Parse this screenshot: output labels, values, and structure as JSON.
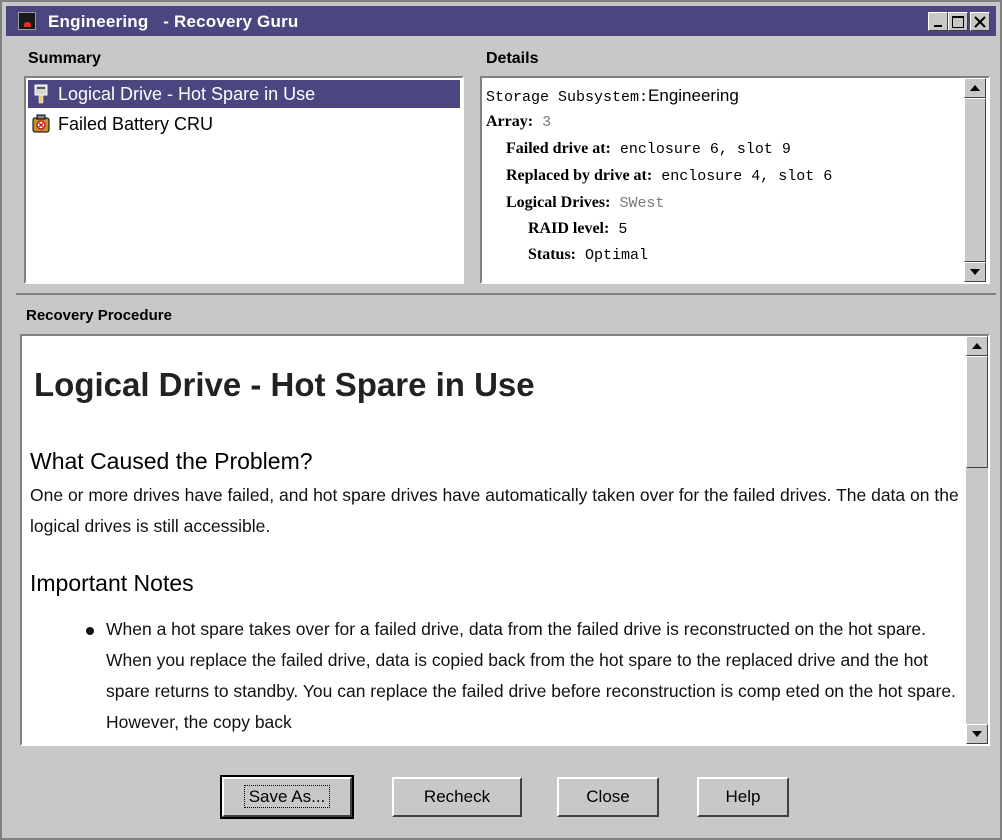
{
  "window": {
    "title": "Engineering   - Recovery Guru",
    "title_bar_color": "#4b4580"
  },
  "summary": {
    "header": "Summary",
    "items": [
      {
        "label": "Logical Drive - Hot Spare in Use",
        "icon": "hot-spare-drive-icon",
        "selected": true
      },
      {
        "label": "Failed Battery CRU",
        "icon": "battery-warning-icon",
        "selected": false
      }
    ]
  },
  "details": {
    "header": "Details",
    "storage_subsystem_label": "Storage Subsystem:",
    "storage_subsystem_value": "Engineering",
    "array_label": "Array:",
    "array_value": "3",
    "failed_drive_label": "Failed drive at:",
    "failed_drive_value": "enclosure 6, slot 9",
    "replaced_by_label": "Replaced by drive at:",
    "replaced_by_value": "enclosure 4, slot 6",
    "logical_drives_label": "Logical Drives:",
    "logical_drives_value": "SWest",
    "raid_level_label": "RAID level:",
    "raid_level_value": "5",
    "status_label": "Status:",
    "status_value": "Optimal"
  },
  "procedure": {
    "header": "Recovery Procedure",
    "title": "Logical Drive - Hot Spare in Use",
    "cause_heading": "What Caused the Problem?",
    "cause_text": "One or more drives have failed, and hot spare drives have automatically taken over for the failed drives. The data on the logical drives is still accessible.",
    "notes_heading": "Important Notes",
    "note_1": "When a hot spare takes over for a failed drive, data from the failed drive is reconstructed on the hot spare. When you replace the failed drive, data is copied back from the hot spare to the replaced drive and the hot spare returns to standby. You can replace the failed drive before reconstruction is comp eted on the hot spare. However, the copy back"
  },
  "buttons": {
    "save_as": "Save As...",
    "recheck": "Recheck",
    "close": "Close",
    "help": "Help"
  }
}
